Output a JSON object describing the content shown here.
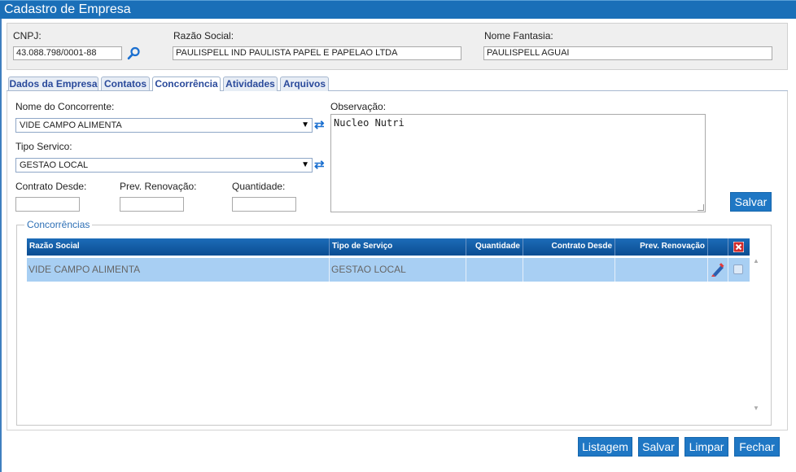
{
  "window": {
    "title": "Cadastro de Empresa"
  },
  "header": {
    "cnpj_label": "CNPJ:",
    "cnpj_value": "43.088.798/0001-88",
    "razao_label": "Razão Social:",
    "razao_value": "PAULISPELL IND PAULISTA PAPEL E PAPELAO LTDA",
    "fantasia_label": "Nome Fantasia:",
    "fantasia_value": "PAULISPELL AGUAI"
  },
  "tabs": [
    {
      "label": "Dados da Empresa"
    },
    {
      "label": "Contatos"
    },
    {
      "label": "Concorrência"
    },
    {
      "label": "Atividades"
    },
    {
      "label": "Arquivos"
    }
  ],
  "active_tab": "Concorrência",
  "form": {
    "concorrente_label": "Nome do Concorrente:",
    "concorrente_value": "VIDE CAMPO ALIMENTA",
    "tipo_label": "Tipo Servico:",
    "tipo_value": "GESTAO LOCAL",
    "contrato_label": "Contrato Desde:",
    "contrato_value": "",
    "renovacao_label": "Prev. Renovação:",
    "renovacao_value": "",
    "quantidade_label": "Quantidade:",
    "quantidade_value": "",
    "observacao_label": "Observação:",
    "observacao_value": "Nucleo Nutri",
    "save_label": "Salvar"
  },
  "concorrencias": {
    "legend": "Concorrências",
    "columns": [
      "Razão Social",
      "Tipo de Serviço",
      "Quantidade",
      "Contrato Desde",
      "Prev. Renovação"
    ],
    "rows": [
      {
        "razao": "VIDE CAMPO ALIMENTA",
        "tipo": "GESTAO LOCAL",
        "quantidade": "",
        "contrato": "",
        "renovacao": ""
      }
    ]
  },
  "footer": {
    "listagem": "Listagem",
    "salvar": "Salvar",
    "limpar": "Limpar",
    "fechar": "Fechar"
  },
  "icons": {
    "search": "search-icon",
    "refresh": "refresh-icon",
    "edit": "edit-icon",
    "delete": "delete-icon"
  },
  "colors": {
    "titlebar": "#1a6fb8",
    "button": "#1f77c4",
    "grid_header": "#0b4d92",
    "grid_row_selected": "#a8cff3",
    "tab_text": "#2a4a9b"
  }
}
